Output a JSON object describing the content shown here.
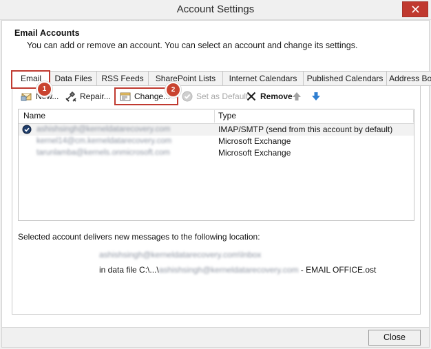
{
  "window": {
    "title": "Account Settings",
    "close_icon": "close-icon"
  },
  "header": {
    "heading": "Email Accounts",
    "subheading": "You can add or remove an account. You can select an account and change its settings."
  },
  "tabs": [
    {
      "label": "Email",
      "active": true
    },
    {
      "label": "Data Files",
      "active": false
    },
    {
      "label": "RSS Feeds",
      "active": false
    },
    {
      "label": "SharePoint Lists",
      "active": false
    },
    {
      "label": "Internet Calendars",
      "active": false
    },
    {
      "label": "Published Calendars",
      "active": false
    },
    {
      "label": "Address Books",
      "active": false
    }
  ],
  "toolbar": {
    "new_label": "New...",
    "repair_label": "Repair...",
    "change_label": "Change...",
    "set_default_label": "Set as Default",
    "remove_label": "Remove",
    "move_up_icon": "arrow-up-icon",
    "move_down_icon": "arrow-down-icon"
  },
  "list": {
    "columns": [
      "Name",
      "Type"
    ],
    "rows": [
      {
        "name": "ashishsingh@kerneldatarecovery.com",
        "type": "IMAP/SMTP (send from this account by default)",
        "selected": true,
        "default": true,
        "redacted": true
      },
      {
        "name": "kernel14@cm.kerneldatarecovery.com",
        "type": "Microsoft Exchange",
        "selected": false,
        "default": false,
        "redacted": true
      },
      {
        "name": "tarunlamba@kernels.onmicrosoft.com",
        "type": "Microsoft Exchange",
        "selected": false,
        "default": false,
        "redacted": true
      }
    ]
  },
  "delivery": {
    "title": "Selected account delivers new messages to the following location:",
    "location": "ashishsingh@kerneldatarecovery.com\\Inbox",
    "datafile_prefix": "in data file C:\\...\\",
    "datafile_redacted": "ashishsingh@kerneldatarecovery.com",
    "datafile_suffix": " - EMAIL OFFICE.ost"
  },
  "footer": {
    "close_label": "Close"
  },
  "annotations": {
    "badge1": "1",
    "badge2": "2",
    "accent_color": "#c9432f"
  }
}
